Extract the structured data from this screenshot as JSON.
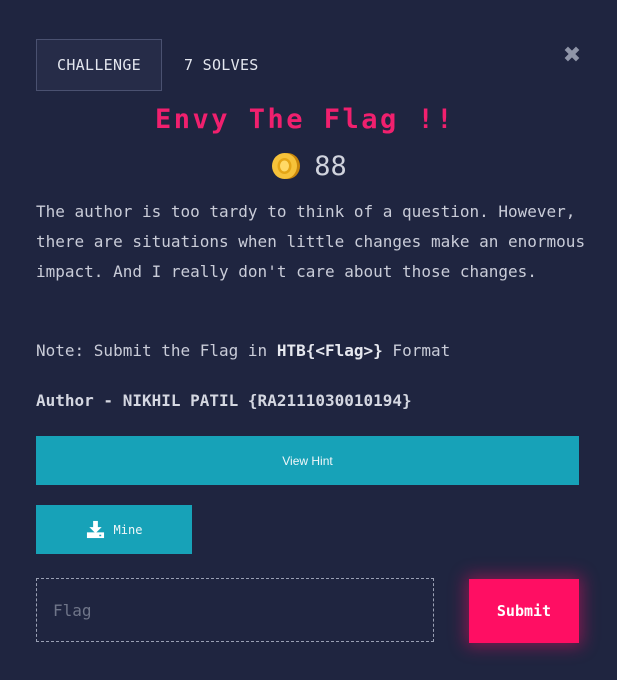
{
  "header": {
    "tabs": [
      {
        "label": "CHALLENGE",
        "active": true
      },
      {
        "label": "7 SOLVES",
        "active": false
      }
    ],
    "close_icon": "close-icon"
  },
  "challenge": {
    "title": "Envy The Flag !!",
    "points": "88",
    "points_icon": "coin-icon",
    "description": "The author is too tardy to think of a question. However, there are situations when little changes make an enormous impact. And I really don't care about those changes.",
    "note_prefix": "Note: Submit the Flag in ",
    "note_format": "HTB{<Flag>}",
    "note_suffix": " Format",
    "author": "Author - NIKHIL PATIL {RA2111030010194}"
  },
  "actions": {
    "hint_label": "View Hint",
    "mine_label": "Mine",
    "mine_icon": "download-icon"
  },
  "submission": {
    "flag_placeholder": "Flag",
    "flag_value": "",
    "submit_label": "Submit"
  },
  "colors": {
    "background": "#1f2540",
    "accent_pink": "#ff0e63",
    "title_pink": "#f0206e",
    "button_teal": "#17a2b8"
  }
}
